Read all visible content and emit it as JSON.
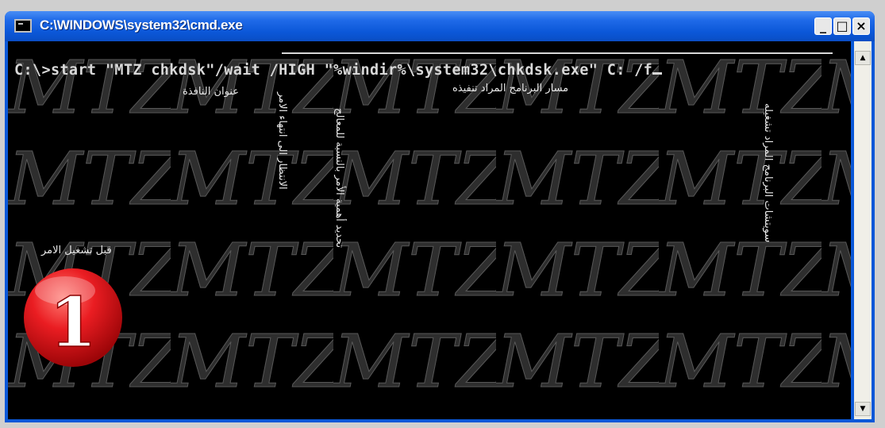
{
  "window": {
    "title": "C:\\WINDOWS\\system32\\cmd.exe",
    "buttons": {
      "minimize": "_",
      "maximize": "□",
      "close": "×"
    }
  },
  "console": {
    "command": "C:\\>start \"MTZ chkdsk\"/wait /HIGH \"%windir%\\system32\\chkdsk.exe\" C: /f"
  },
  "annotations": {
    "window_title": "عنوان النافذة",
    "wait": "الانتظار الى انتهاء الامر",
    "priority": "تحديد أهمية الأمر بالنسبة للمعالج",
    "program_path": "مسار البرنامج المراد تنفيذه",
    "program_args": "سويتشات البرنامج المراد تشغيله",
    "before_run": "قبل تشغيل الامر"
  },
  "badge": {
    "number": "1",
    "color": "#e8121a"
  },
  "watermark": {
    "text": "MTZ"
  },
  "colors": {
    "titlebar": "#0b57d8",
    "console_bg": "#000000",
    "console_text": "#d8d8d8"
  }
}
